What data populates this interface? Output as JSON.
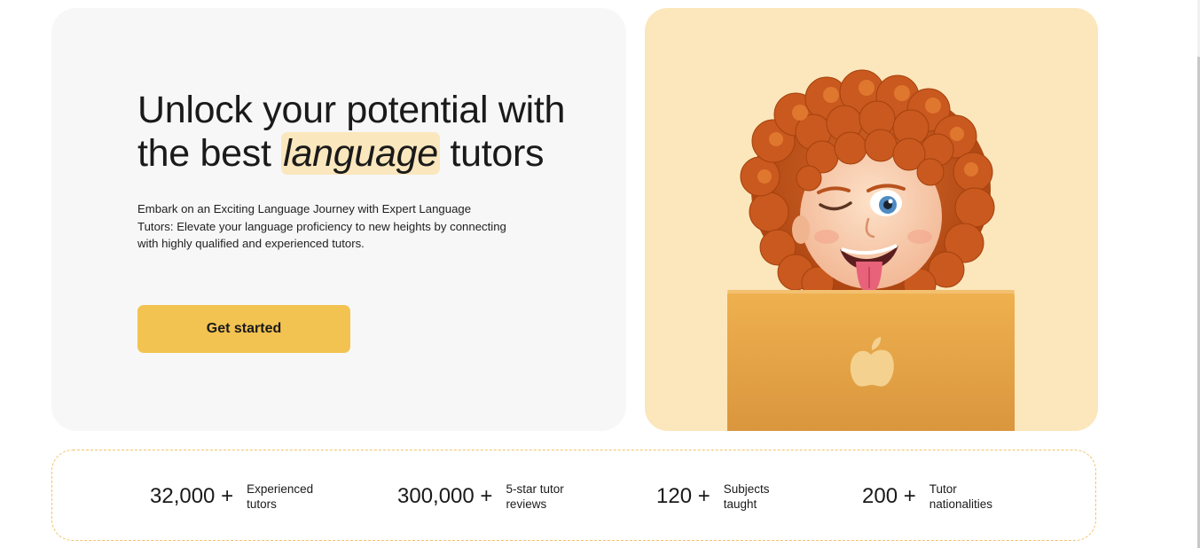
{
  "hero": {
    "title_part1": "Unlock your potential with the best ",
    "title_highlight": "language",
    "title_part2": " tutors",
    "description": "Embark on an Exciting Language Journey with Expert Language Tutors: Elevate your language proficiency to new heights by connecting with highly qualified and experienced tutors.",
    "cta_label": "Get started"
  },
  "image": {
    "subject": "curly-haired memoji winking with tongue out behind a laptop",
    "icons": [
      "memoji-avatar",
      "laptop",
      "apple-logo-icon"
    ]
  },
  "stats": [
    {
      "value": "32,000 +",
      "label": "Experienced tutors"
    },
    {
      "value": "300,000 +",
      "label": "5-star tutor reviews"
    },
    {
      "value": "120 +",
      "label": "Subjects taught"
    },
    {
      "value": "200 +",
      "label": "Tutor nationalities"
    }
  ],
  "colors": {
    "accent": "#f3c352",
    "highlight": "#fbe7bd",
    "hero_card_bg": "#f7f7f7",
    "image_card_bg": "#fbe7bb",
    "stats_border": "#f1c46a"
  }
}
